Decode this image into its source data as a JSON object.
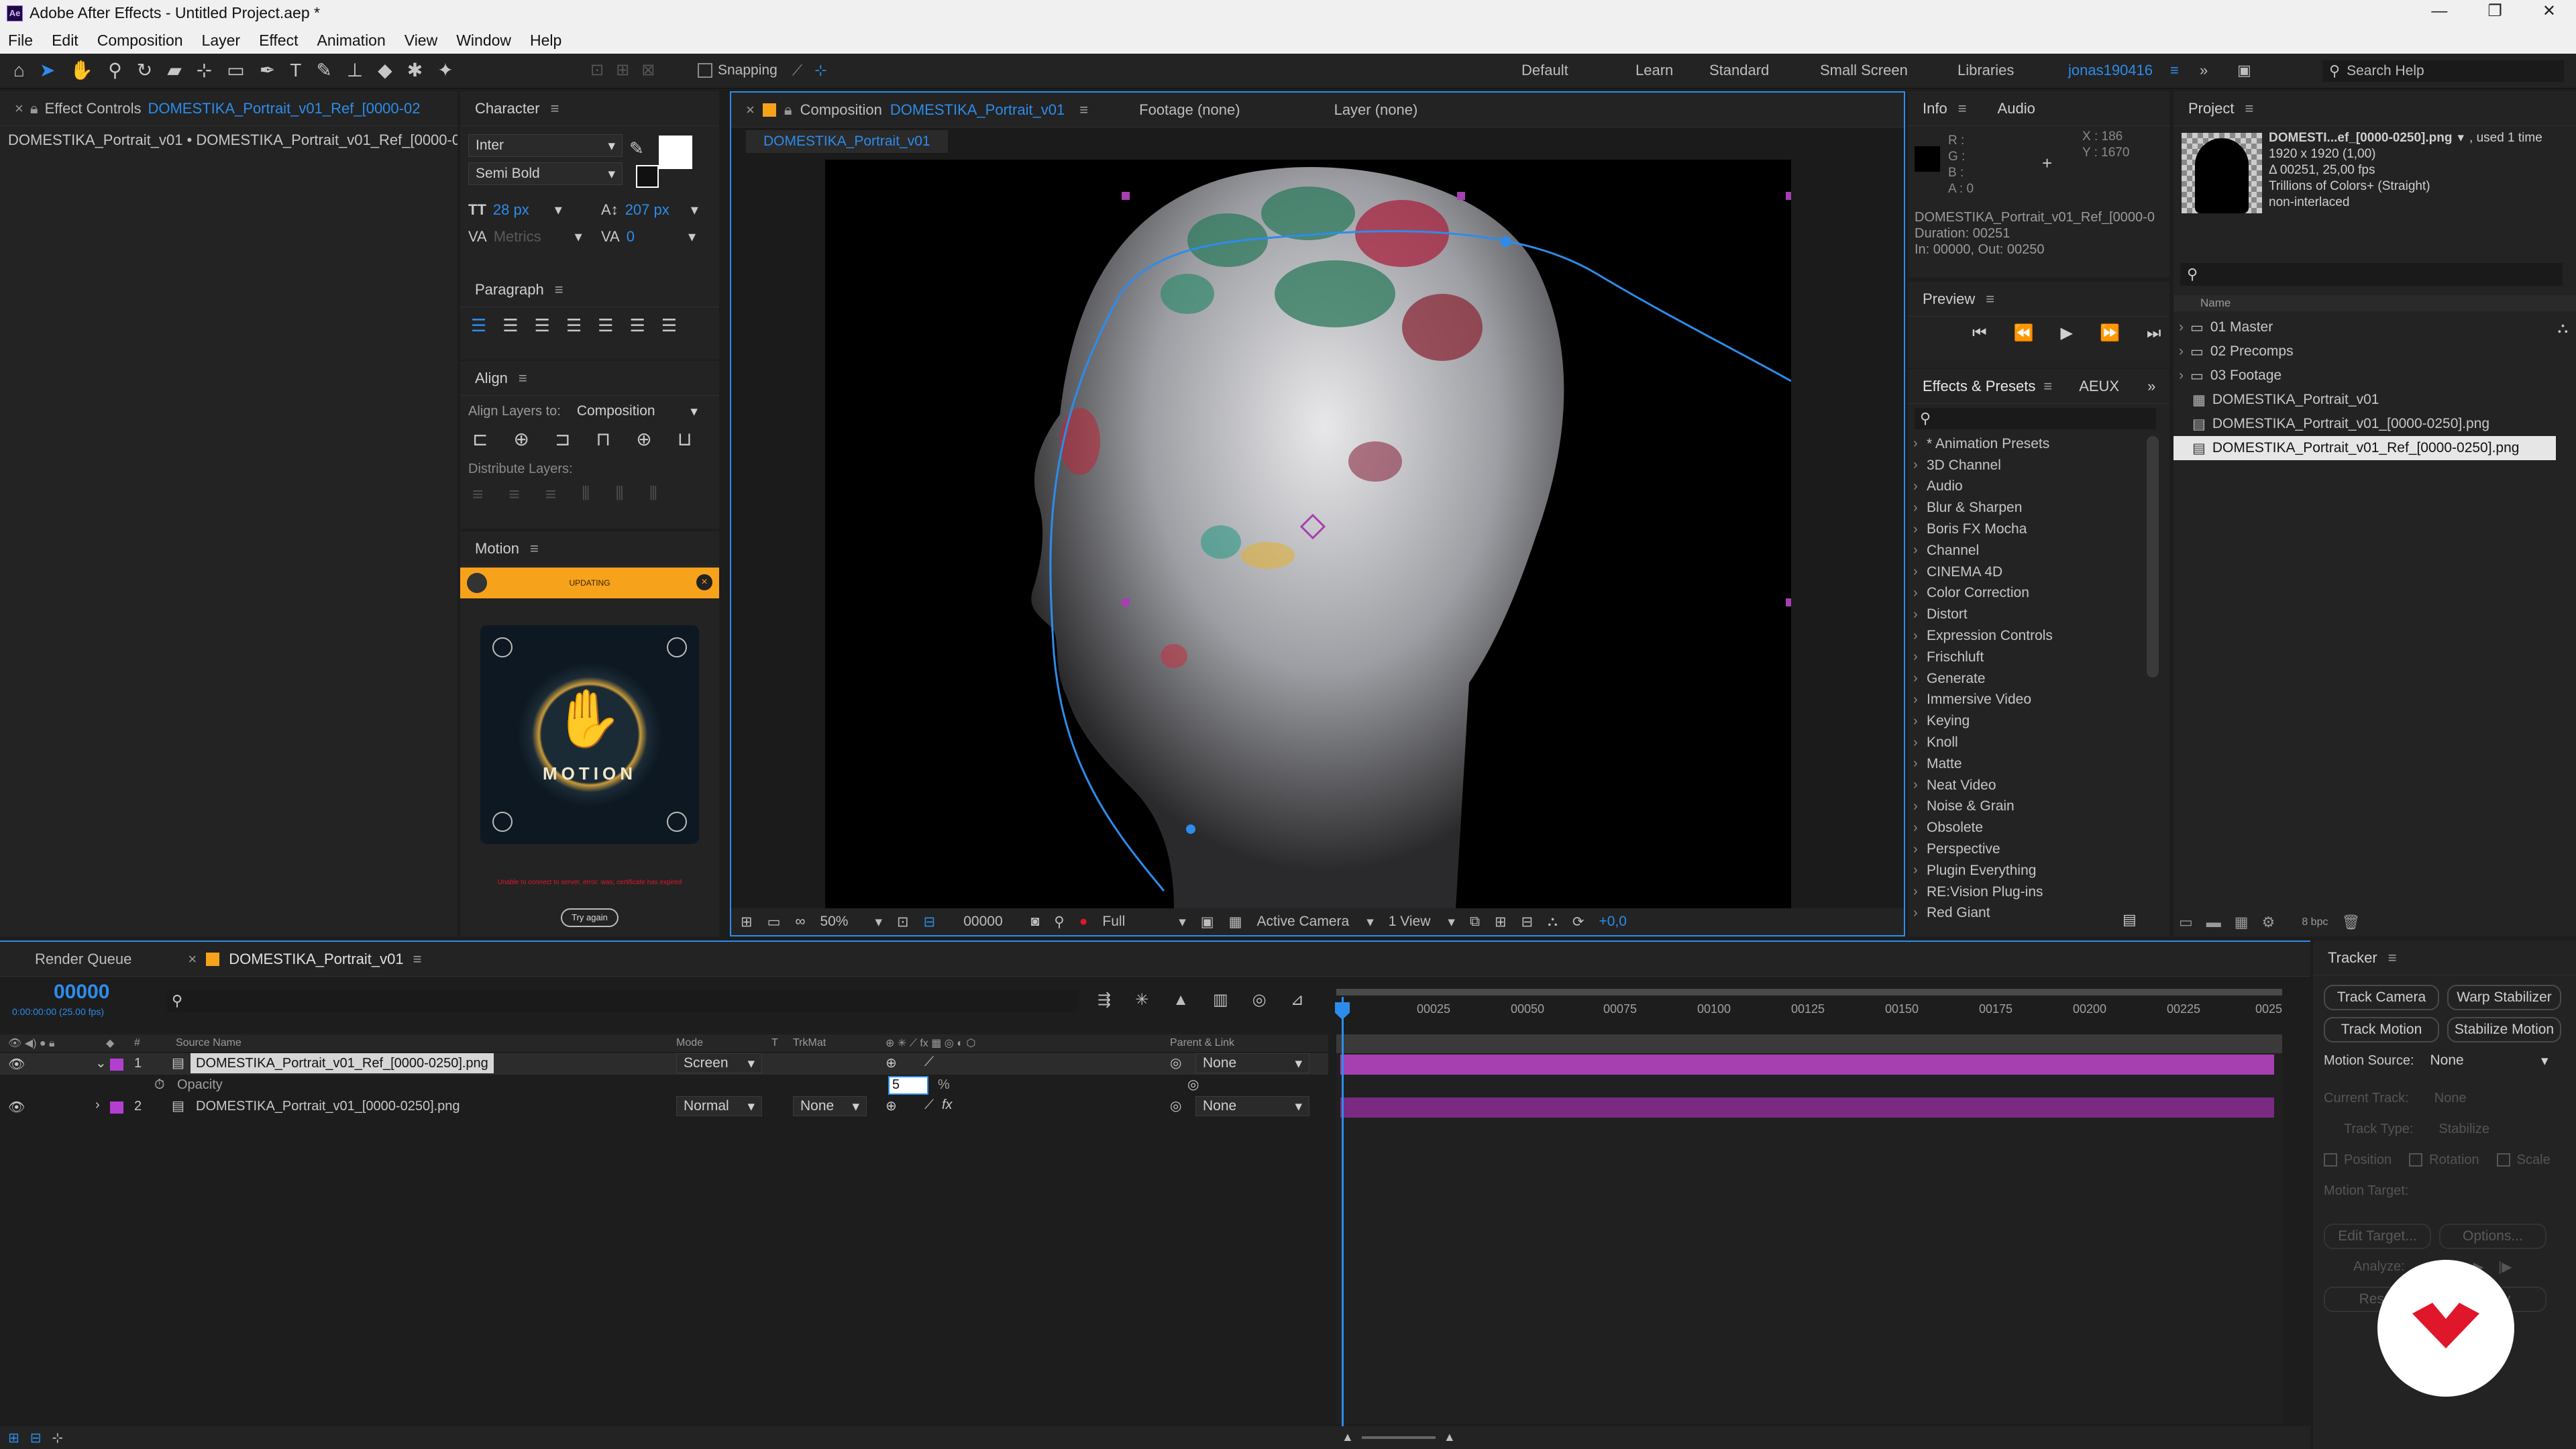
{
  "app": {
    "title": "Adobe After Effects - Untitled Project.aep *",
    "menu": [
      "File",
      "Edit",
      "Composition",
      "Layer",
      "Effect",
      "Animation",
      "View",
      "Window",
      "Help"
    ]
  },
  "toolbar": {
    "snapping_label": "Snapping",
    "workspaces": [
      "Default",
      "Learn",
      "Standard",
      "Small Screen",
      "Libraries"
    ],
    "user": "jonas190416",
    "search_placeholder": "Search Help"
  },
  "effect_controls": {
    "tab_prefix": "Effect Controls",
    "tab_layer": "DOMESTIKA_Portrait_v01_Ref_[0000-02",
    "breadcrumb": "DOMESTIKA_Portrait_v01 • DOMESTIKA_Portrait_v01_Ref_[0000-025("
  },
  "character": {
    "title": "Character",
    "font": "Inter",
    "style": "Semi Bold",
    "size": "28 px",
    "leading": "207 px",
    "kerning": "Metrics",
    "tracking": "0"
  },
  "paragraph": {
    "title": "Paragraph"
  },
  "align": {
    "title": "Align",
    "align_to_label": "Align Layers to:",
    "align_to_value": "Composition",
    "distribute_label": "Distribute Layers:"
  },
  "motion": {
    "title": "Motion",
    "status": "UPDATING",
    "logo_text": "MOTION",
    "error": "Unable to connect to server, error: was; certificate has expired",
    "try_again": "Try again"
  },
  "composition": {
    "tab_label": "Composition",
    "tab_name": "DOMESTIKA_Portrait_v01",
    "footage_tab": "Footage (none)",
    "layer_tab": "Layer (none)",
    "breadcrumb": "DOMESTIKA_Portrait_v01",
    "zoom": "50%",
    "timecode": "00000",
    "resolution": "Full",
    "camera": "Active Camera",
    "views": "1 View",
    "exposure": "+0,0"
  },
  "info": {
    "title": "Info",
    "audio_tab": "Audio",
    "r": "R :",
    "g": "G :",
    "b": "B :",
    "a": "A : 0",
    "x": "X : 186",
    "y": "Y : 1670",
    "line1": "DOMESTIKA_Portrait_v01_Ref_[0000-0",
    "line2": "Duration: 00251",
    "line3": "In: 00000, Out: 00250"
  },
  "preview": {
    "title": "Preview"
  },
  "effects": {
    "title": "Effects & Presets",
    "aeux_tab": "AEUX",
    "items": [
      "* Animation Presets",
      "3D Channel",
      "Audio",
      "Blur & Sharpen",
      "Boris FX Mocha",
      "Channel",
      "CINEMA 4D",
      "Color Correction",
      "Distort",
      "Expression Controls",
      "Frischluft",
      "Generate",
      "Immersive Video",
      "Keying",
      "Knoll",
      "Matte",
      "Neat Video",
      "Noise & Grain",
      "Obsolete",
      "Perspective",
      "Plugin Everything",
      "RE:Vision Plug-ins",
      "Red Giant"
    ]
  },
  "project": {
    "title": "Project",
    "selected_name": "DOMESTI...ef_[0000-0250].png",
    "used": ", used 1 time",
    "meta1": "1920 x 1920 (1,00)",
    "meta2": "Δ 00251, 25,00 fps",
    "meta3": "Trillions of Colors+ (Straight)",
    "meta4": "non-interlaced",
    "col_name": "Name",
    "items": [
      {
        "name": "01 Master",
        "type": "folder"
      },
      {
        "name": "02 Precomps",
        "type": "folder"
      },
      {
        "name": "03 Footage",
        "type": "folder"
      },
      {
        "name": "DOMESTIKA_Portrait_v01",
        "type": "comp"
      },
      {
        "name": "DOMESTIKA_Portrait_v01_[0000-0250].png",
        "type": "footage"
      },
      {
        "name": "DOMESTIKA_Portrait_v01_Ref_[0000-0250].png",
        "type": "footage",
        "selected": true
      }
    ],
    "bpc": "8 bpc"
  },
  "timeline": {
    "render_queue": "Render Queue",
    "comp_tab": "DOMESTIKA_Portrait_v01",
    "timecode": "00000",
    "sub_timecode": "0:00:00:00 (25.00 fps)",
    "headers": {
      "source": "Source Name",
      "mode": "Mode",
      "t": "T",
      "trkmat": "TrkMat",
      "parent": "Parent & Link"
    },
    "layers": [
      {
        "num": "1",
        "name": "DOMESTIKA_Portrait_v01_Ref_[0000-0250].png",
        "mode": "Screen",
        "trkmat": "",
        "parent": "None"
      },
      {
        "num": "2",
        "name": "DOMESTIKA_Portrait_v01_[0000-0250].png",
        "mode": "Normal",
        "trkmat": "None",
        "parent": "None"
      }
    ],
    "opacity_label": "Opacity",
    "opacity_value": "5",
    "opacity_unit": "%",
    "ruler": [
      "00025",
      "00050",
      "00075",
      "00100",
      "00125",
      "00150",
      "00175",
      "00200",
      "00225",
      "0025"
    ]
  },
  "tracker": {
    "title": "Tracker",
    "track_camera": "Track Camera",
    "warp_stabilizer": "Warp Stabilizer",
    "track_motion": "Track Motion",
    "stabilize_motion": "Stabilize Motion",
    "motion_source_label": "Motion Source:",
    "motion_source_value": "None",
    "current_track_label": "Current Track:",
    "current_track_value": "None",
    "track_type_label": "Track Type:",
    "track_type_value": "Stabilize",
    "position": "Position",
    "rotation": "Rotation",
    "scale": "Scale",
    "motion_target": "Motion Target:",
    "edit_target": "Edit Target...",
    "options": "Options...",
    "analyze": "Analyze:",
    "reset": "Reset",
    "apply": "Apply"
  },
  "colors": {
    "accent_blue": "#2d8ceb",
    "layer_purple": "#a63fb0",
    "label_purple": "#b33fd0",
    "motion_orange": "#f7a21b",
    "domestika_red": "#e0162b"
  }
}
